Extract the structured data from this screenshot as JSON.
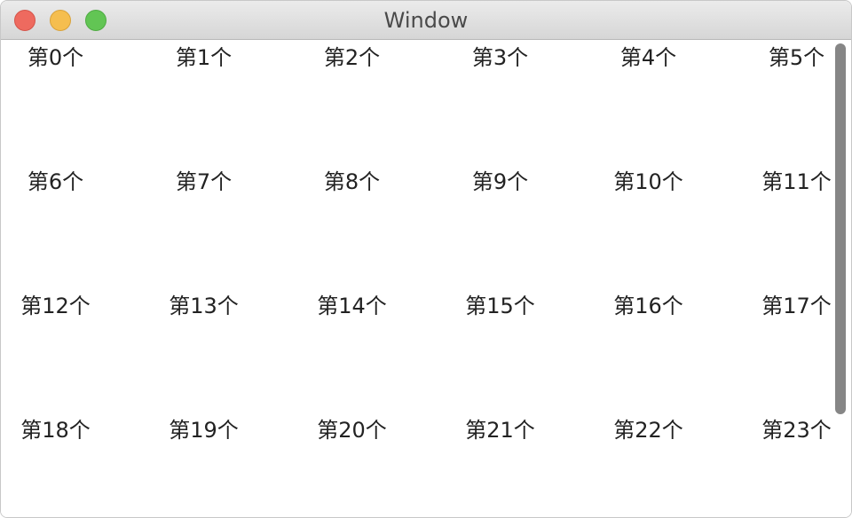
{
  "window": {
    "title": "Window"
  },
  "grid": {
    "items": [
      "第0个",
      "第1个",
      "第2个",
      "第3个",
      "第4个",
      "第5个",
      "第6个",
      "第7个",
      "第8个",
      "第9个",
      "第10个",
      "第11个",
      "第12个",
      "第13个",
      "第14个",
      "第15个",
      "第16个",
      "第17个",
      "第18个",
      "第19个",
      "第20个",
      "第21个",
      "第22个",
      "第23个"
    ]
  },
  "colors": {
    "close": "#ee6a5f",
    "minimize": "#f5be4f",
    "zoom": "#62c554",
    "scrollbar": "#868686"
  }
}
